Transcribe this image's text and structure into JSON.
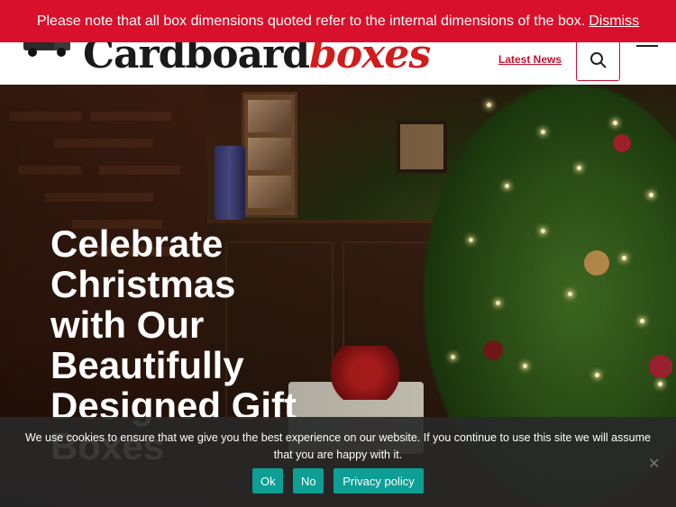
{
  "notice": {
    "message": "Please note that all box dimensions quoted refer to the internal dimensions of the box.",
    "dismiss_label": "Dismiss"
  },
  "header": {
    "logo_main": "Cardboard",
    "logo_accent": "boxes",
    "latest_news_label": "Latest News",
    "search_icon": "search-icon",
    "menu_icon": "hamburger-menu-icon"
  },
  "hero": {
    "title": "Celebrate Christmas with Our Beautifully Designed Gift Boxes"
  },
  "cookie": {
    "message": "We use cookies to ensure that we give you the best experience on our website. If you continue to use this site we will assume that you are happy with it.",
    "ok_label": "Ok",
    "no_label": "No",
    "privacy_label": "Privacy policy",
    "close_glyph": "✕"
  },
  "colors": {
    "brand_red": "#d8102b",
    "cookie_button": "#0d9e95"
  }
}
